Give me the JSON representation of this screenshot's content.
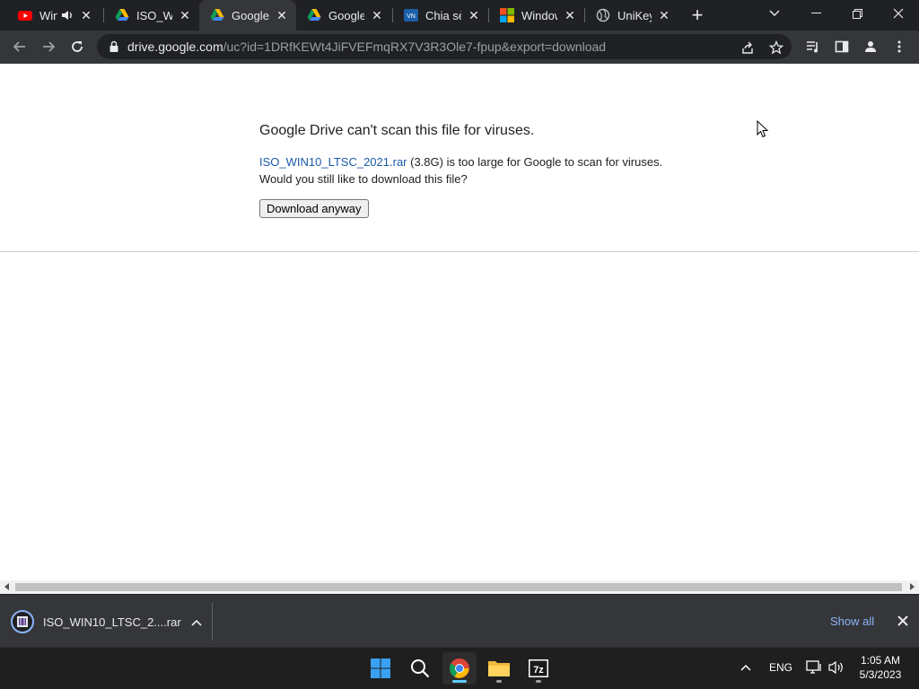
{
  "browser": {
    "tabs": [
      {
        "title": "Win",
        "icon": "youtube-icon",
        "audio": true
      },
      {
        "title": "ISO_WI",
        "icon": "google-drive-icon"
      },
      {
        "title": "Google",
        "icon": "google-drive-icon",
        "active": true
      },
      {
        "title": "Google",
        "icon": "google-drive-icon"
      },
      {
        "title": "Chia sẻ",
        "icon": "vn-site-icon"
      },
      {
        "title": "Window",
        "icon": "microsoft-icon"
      },
      {
        "title": "UniKey",
        "icon": "globe-icon"
      }
    ],
    "new_tab_label": "+",
    "url_host": "drive.google.com",
    "url_path": "/uc?id=1DRfKEWt4JiFVEFmqRX7V3R3Ole7-fpup&export=download"
  },
  "page": {
    "heading": "Google Drive can't scan this file for viruses.",
    "file_link": "ISO_WIN10_LTSC_2021.rar",
    "message_rest": " (3.8G) is too large for Google to scan for viruses.",
    "message_line2": "Would you still like to download this file?",
    "download_button": "Download anyway"
  },
  "downloads": {
    "item_name": "ISO_WIN10_LTSC_2....rar",
    "show_all": "Show all"
  },
  "taskbar": {
    "apps": [
      "windows-start-icon",
      "search-icon",
      "chrome-icon",
      "file-explorer-icon",
      "7zip-icon"
    ],
    "language": "ENG",
    "time": "1:05 AM",
    "date": "5/3/2023"
  },
  "colors": {
    "link": "#1a5aa6",
    "accent": "#8ab4f8",
    "frame": "#202124",
    "toolbar": "#35363a"
  }
}
